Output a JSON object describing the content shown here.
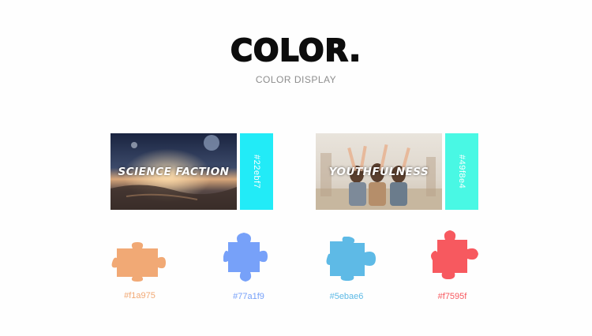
{
  "header": {
    "title": "COLOR.",
    "subtitle": "COLOR DISPLAY"
  },
  "cards": [
    {
      "caption": "SCIENCE FACTION",
      "hex": "#22ebf7",
      "color": "#22ebf7"
    },
    {
      "caption": "YOUTHFULNESS",
      "hex": "#49f8e4",
      "color": "#49f8e4"
    }
  ],
  "palette": [
    {
      "hex": "#f1a975",
      "color": "#f1a975"
    },
    {
      "hex": "#77a1f9",
      "color": "#77a1f9"
    },
    {
      "hex": "#5ebae6",
      "color": "#5ebae6"
    },
    {
      "hex": "#f7595f",
      "color": "#f7595f"
    }
  ]
}
